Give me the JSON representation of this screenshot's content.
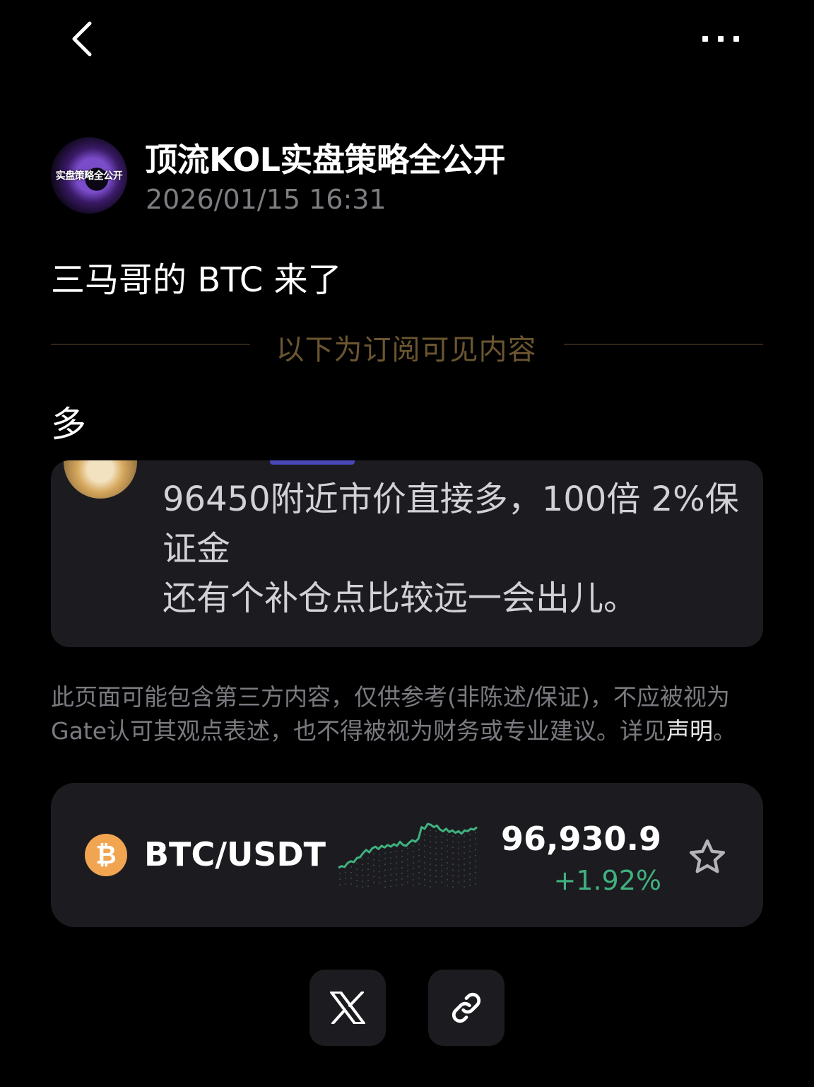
{
  "nav": {
    "back_icon": "chevron-left-icon",
    "more_icon": "more-dots-icon"
  },
  "author": {
    "avatar_text": "实盘策略全公开",
    "name": "顶流KOL实盘策略全公开",
    "time": "2026/01/15 16:31"
  },
  "post": {
    "title": "三马哥的 BTC 来了",
    "subscription_label": "以下为订阅可见内容",
    "body": "多"
  },
  "quote": {
    "line1": "96450附近市价直接多，100倍  2%保证金",
    "line2": "还有个补仓点比较远一会出儿。"
  },
  "disclaimer": {
    "text": "此页面可能包含第三方内容，仅供参考(非陈述/保证)，不应被视为Gate认可其观点表述，也不得被视为财务或专业建议。详见",
    "link": "声明",
    "end": "。"
  },
  "ticker": {
    "icon": "bitcoin-icon",
    "icon_glyph": "₿",
    "pair": "BTC/USDT",
    "price": "96,930.9",
    "change": "+1.92%",
    "change_color": "#3fb27f",
    "sparkline_color": "#3fb27f",
    "sparkline": [
      2,
      4,
      3,
      8,
      10,
      9,
      14,
      15,
      20,
      24,
      21,
      26,
      28,
      25,
      29,
      27,
      30,
      28,
      31,
      29,
      34,
      30,
      29,
      33,
      36,
      34,
      38,
      52,
      50,
      56,
      55,
      52,
      54,
      49,
      47,
      50,
      46,
      48,
      45,
      47,
      44,
      48,
      47,
      50,
      49,
      52
    ]
  },
  "share": {
    "x_icon": "x-logo-icon",
    "link_icon": "link-icon"
  }
}
